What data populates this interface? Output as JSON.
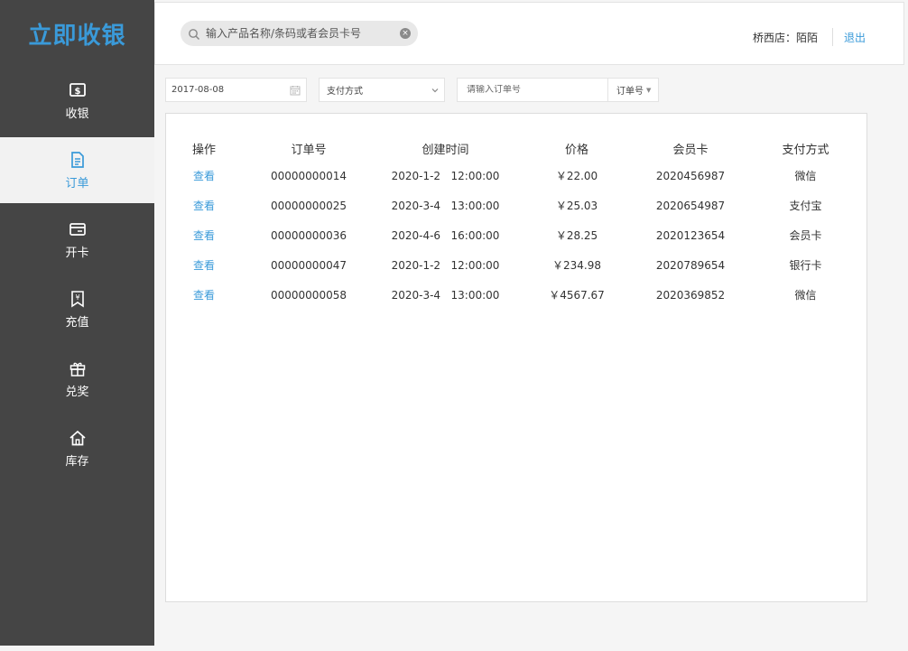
{
  "app": {
    "logo": "立即收银"
  },
  "sidebar": {
    "items": [
      {
        "label": "收银",
        "icon": "cash-register-icon"
      },
      {
        "label": "订单",
        "icon": "order-document-icon",
        "active": true
      },
      {
        "label": "开卡",
        "icon": "card-icon"
      },
      {
        "label": "充值",
        "icon": "recharge-icon"
      },
      {
        "label": "兑奖",
        "icon": "gift-icon"
      },
      {
        "label": "库存",
        "icon": "home-icon"
      }
    ]
  },
  "header": {
    "search_placeholder": "输入产品名称/条码或者会员卡号",
    "store_text": "桥西店：陌陌",
    "logout_label": "退出"
  },
  "filters": {
    "date": "2017-08-08",
    "payment_method": "支付方式",
    "order_placeholder": "请输入订单号",
    "order_type": "订单号"
  },
  "orders": {
    "headers": [
      "操作",
      "订单号",
      "创建时间",
      "价格",
      "会员卡",
      "支付方式"
    ],
    "view_label": "查看",
    "rows": [
      {
        "id": "00000000014",
        "created": "2020-1-2   12:00:00",
        "price": "￥22.00",
        "card": "2020456987",
        "pay": "微信"
      },
      {
        "id": "00000000025",
        "created": "2020-3-4   13:00:00",
        "price": "￥25.03",
        "card": "2020654987",
        "pay": "支付宝"
      },
      {
        "id": "00000000036",
        "created": "2020-4-6   16:00:00",
        "price": "￥28.25",
        "card": "2020123654",
        "pay": "会员卡"
      },
      {
        "id": "00000000047",
        "created": "2020-1-2   12:00:00",
        "price": "￥234.98",
        "card": "2020789654",
        "pay": "银行卡"
      },
      {
        "id": "00000000058",
        "created": "2020-3-4   13:00:00",
        "price": "￥4567.67",
        "card": "2020369852",
        "pay": "微信"
      }
    ]
  },
  "colors": {
    "accent": "#3a9ad9",
    "sidebar_bg": "#454545"
  }
}
